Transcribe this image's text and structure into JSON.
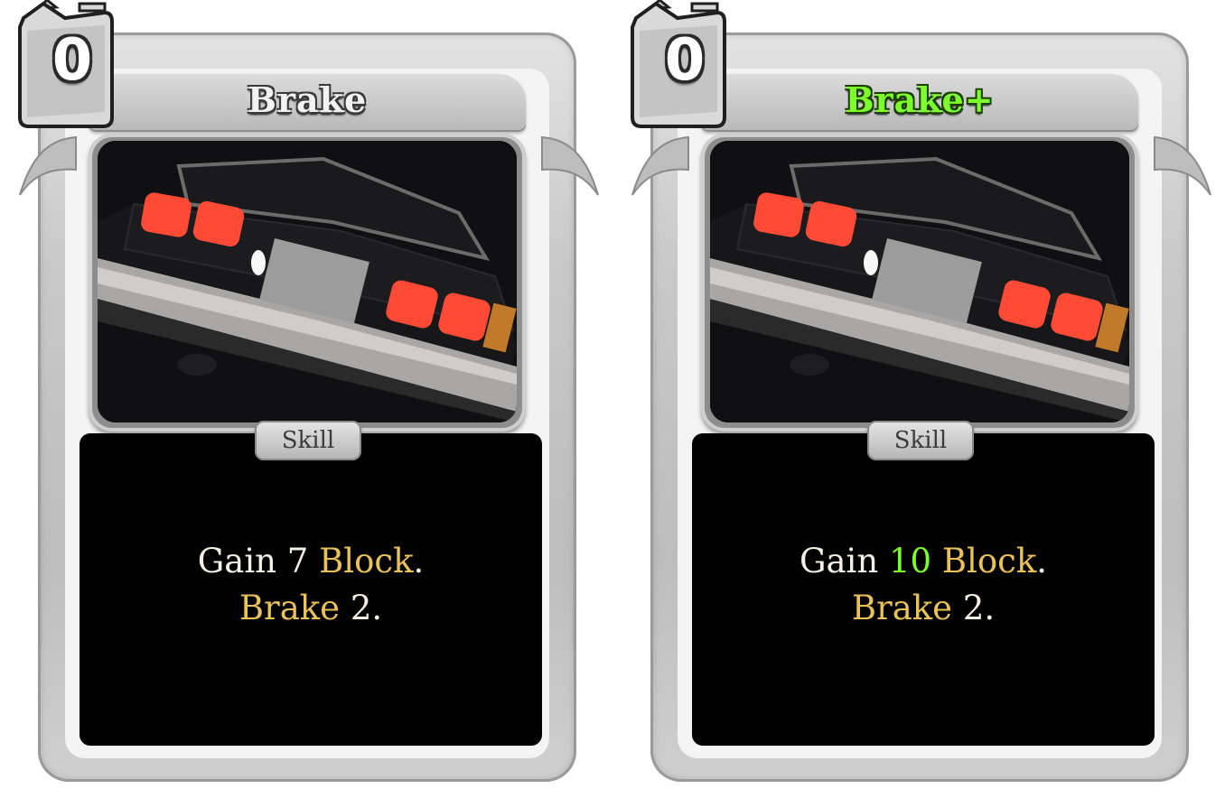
{
  "cards": [
    {
      "id": "card-left",
      "cost": "0",
      "title": "Brake",
      "type": "Skill",
      "description": {
        "line1_prefix": "Gain ",
        "block_amount": "7",
        "block_keyword": "Block",
        "line1_suffix": ".",
        "brake_keyword": "Brake",
        "brake_amount": " 2."
      },
      "title_color": "#f2f2f2",
      "amount_color": "#f4f0e6"
    },
    {
      "id": "card-right",
      "cost": "0",
      "title": "Brake+",
      "type": "Skill",
      "description": {
        "line1_prefix": "Gain ",
        "block_amount": "10",
        "block_keyword": "Block",
        "line1_suffix": ".",
        "brake_keyword": "Brake",
        "brake_amount": " 2."
      },
      "title_color": "#7dff2b",
      "amount_color": "#7dff2b"
    }
  ],
  "colors": {
    "keyword": "#e9c25a",
    "upgrade": "#7dff2b",
    "frame": "#c9c9c9",
    "panel": "#000000"
  },
  "icons": {
    "cost": "fuel-canister-icon",
    "art": "car-rear-taillights-image"
  }
}
